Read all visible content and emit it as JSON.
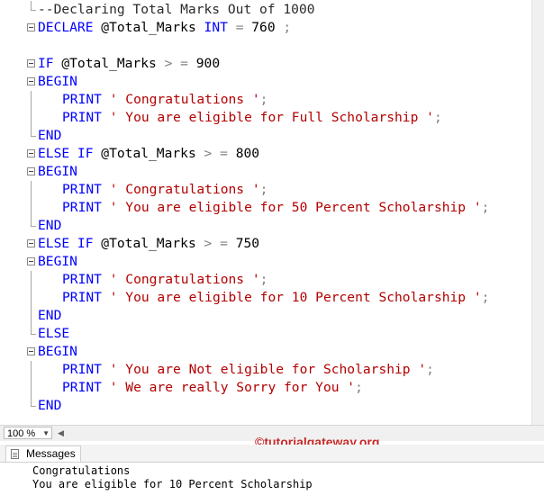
{
  "editor": {
    "lines": [
      {
        "gutter": "vend",
        "indent": false,
        "tokens": [
          {
            "cls": "cm",
            "text": "--Declaring Total Marks Out of 1000"
          }
        ]
      },
      {
        "gutter": "box",
        "indent": false,
        "tokens": [
          {
            "cls": "kw",
            "text": "DECLARE "
          },
          {
            "cls": "var",
            "text": "@Total_Marks "
          },
          {
            "cls": "kw",
            "text": "INT "
          },
          {
            "cls": "op",
            "text": "= "
          },
          {
            "cls": "num",
            "text": "760 "
          },
          {
            "cls": "op",
            "text": ";"
          }
        ]
      },
      {
        "gutter": "",
        "indent": false,
        "tokens": []
      },
      {
        "gutter": "box",
        "indent": false,
        "tokens": [
          {
            "cls": "kw",
            "text": "IF "
          },
          {
            "cls": "var",
            "text": "@Total_Marks "
          },
          {
            "cls": "op",
            "text": "> = "
          },
          {
            "cls": "num",
            "text": "900"
          }
        ]
      },
      {
        "gutter": "box",
        "indent": false,
        "tokens": [
          {
            "cls": "kw",
            "text": "BEGIN"
          }
        ]
      },
      {
        "gutter": "v",
        "indent": true,
        "tokens": [
          {
            "cls": "kw",
            "text": "PRINT "
          },
          {
            "cls": "str",
            "text": "' Congratulations '"
          },
          {
            "cls": "op",
            "text": ";"
          }
        ]
      },
      {
        "gutter": "v",
        "indent": true,
        "tokens": [
          {
            "cls": "kw",
            "text": "PRINT "
          },
          {
            "cls": "str",
            "text": "' You are eligible for Full Scholarship '"
          },
          {
            "cls": "op",
            "text": ";"
          }
        ]
      },
      {
        "gutter": "vend",
        "indent": false,
        "tokens": [
          {
            "cls": "kw",
            "text": "END"
          }
        ]
      },
      {
        "gutter": "box",
        "indent": false,
        "tokens": [
          {
            "cls": "kw",
            "text": "ELSE IF "
          },
          {
            "cls": "var",
            "text": "@Total_Marks "
          },
          {
            "cls": "op",
            "text": "> = "
          },
          {
            "cls": "num",
            "text": "800"
          }
        ]
      },
      {
        "gutter": "box",
        "indent": false,
        "tokens": [
          {
            "cls": "kw",
            "text": "BEGIN"
          }
        ]
      },
      {
        "gutter": "v",
        "indent": true,
        "tokens": [
          {
            "cls": "kw",
            "text": "PRINT "
          },
          {
            "cls": "str",
            "text": "' Congratulations '"
          },
          {
            "cls": "op",
            "text": ";"
          }
        ]
      },
      {
        "gutter": "v",
        "indent": true,
        "tokens": [
          {
            "cls": "kw",
            "text": "PRINT "
          },
          {
            "cls": "str",
            "text": "' You are eligible for 50 Percent Scholarship '"
          },
          {
            "cls": "op",
            "text": ";"
          }
        ]
      },
      {
        "gutter": "vend",
        "indent": false,
        "tokens": [
          {
            "cls": "kw",
            "text": "END"
          }
        ]
      },
      {
        "gutter": "box",
        "indent": false,
        "tokens": [
          {
            "cls": "kw",
            "text": "ELSE IF "
          },
          {
            "cls": "var",
            "text": "@Total_Marks "
          },
          {
            "cls": "op",
            "text": "> = "
          },
          {
            "cls": "num",
            "text": "750"
          }
        ]
      },
      {
        "gutter": "box",
        "indent": false,
        "tokens": [
          {
            "cls": "kw",
            "text": "BEGIN"
          }
        ]
      },
      {
        "gutter": "v",
        "indent": true,
        "tokens": [
          {
            "cls": "kw",
            "text": "PRINT "
          },
          {
            "cls": "str",
            "text": "' Congratulations '"
          },
          {
            "cls": "op",
            "text": ";"
          }
        ]
      },
      {
        "gutter": "v",
        "indent": true,
        "tokens": [
          {
            "cls": "kw",
            "text": "PRINT "
          },
          {
            "cls": "str",
            "text": "' You are eligible for 10 Percent Scholarship '"
          },
          {
            "cls": "op",
            "text": ";"
          }
        ]
      },
      {
        "gutter": "v",
        "indent": false,
        "tokens": [
          {
            "cls": "kw",
            "text": "END"
          }
        ]
      },
      {
        "gutter": "vend",
        "indent": false,
        "tokens": [
          {
            "cls": "kw",
            "text": "ELSE"
          }
        ]
      },
      {
        "gutter": "box",
        "indent": false,
        "tokens": [
          {
            "cls": "kw",
            "text": "BEGIN"
          }
        ]
      },
      {
        "gutter": "v",
        "indent": true,
        "tokens": [
          {
            "cls": "kw",
            "text": "PRINT "
          },
          {
            "cls": "str",
            "text": "' You are Not eligible for Scholarship '"
          },
          {
            "cls": "op",
            "text": ";"
          }
        ]
      },
      {
        "gutter": "v",
        "indent": true,
        "tokens": [
          {
            "cls": "kw",
            "text": "PRINT "
          },
          {
            "cls": "str",
            "text": "' We are really Sorry for You '"
          },
          {
            "cls": "op",
            "text": ";"
          }
        ]
      },
      {
        "gutter": "vend",
        "indent": false,
        "tokens": [
          {
            "cls": "kw",
            "text": "END"
          }
        ]
      }
    ]
  },
  "statusbar": {
    "zoom": "100 %"
  },
  "watermark": "©tutorialgateway.org",
  "messages": {
    "tab_label": "Messages",
    "lines": [
      "Congratulations",
      "You are eligible for 10 Percent Scholarship"
    ]
  },
  "colors": {
    "keyword": "#0000ff",
    "string": "#b30000",
    "operator": "#808080",
    "watermark": "#c62828"
  }
}
